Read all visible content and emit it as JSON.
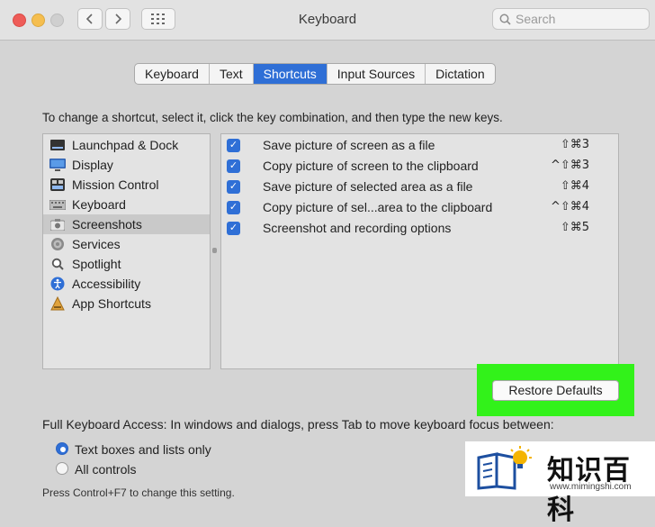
{
  "window": {
    "title": "Keyboard"
  },
  "search": {
    "placeholder": "Search"
  },
  "tabs": [
    {
      "label": "Keyboard",
      "active": false
    },
    {
      "label": "Text",
      "active": false
    },
    {
      "label": "Shortcuts",
      "active": true
    },
    {
      "label": "Input Sources",
      "active": false
    },
    {
      "label": "Dictation",
      "active": false
    }
  ],
  "intro_text": "To change a shortcut, select it, click the key combination, and then type the new keys.",
  "categories": [
    {
      "label": "Launchpad & Dock",
      "icon": "launchpad-icon",
      "selected": false
    },
    {
      "label": "Display",
      "icon": "display-icon",
      "selected": false
    },
    {
      "label": "Mission Control",
      "icon": "mission-control-icon",
      "selected": false
    },
    {
      "label": "Keyboard",
      "icon": "keyboard-icon",
      "selected": false
    },
    {
      "label": "Screenshots",
      "icon": "screenshot-icon",
      "selected": true
    },
    {
      "label": "Services",
      "icon": "gear-icon",
      "selected": false
    },
    {
      "label": "Spotlight",
      "icon": "spotlight-icon",
      "selected": false
    },
    {
      "label": "Accessibility",
      "icon": "accessibility-icon",
      "selected": false
    },
    {
      "label": "App Shortcuts",
      "icon": "app-shortcuts-icon",
      "selected": false
    }
  ],
  "shortcuts": [
    {
      "label": "Save picture of screen as a file",
      "keys": "⇧⌘3",
      "checked": true
    },
    {
      "label": "Copy picture of screen to the clipboard",
      "keys": "^⇧⌘3",
      "checked": true
    },
    {
      "label": "Save picture of selected area as a file",
      "keys": "⇧⌘4",
      "checked": true
    },
    {
      "label": "Copy picture of sel...area to the clipboard",
      "keys": "^⇧⌘4",
      "checked": true
    },
    {
      "label": "Screenshot and recording options",
      "keys": "⇧⌘5",
      "checked": true
    }
  ],
  "restore_label": "Restore Defaults",
  "full_keyboard_access": {
    "text": "Full Keyboard Access: In windows and dialogs, press Tab to move keyboard focus between:",
    "options": [
      {
        "label": "Text boxes and lists only",
        "selected": true
      },
      {
        "label": "All controls",
        "selected": false
      }
    ],
    "note": "Press Control+F7 to change this setting."
  },
  "watermark": {
    "text": "知识百科",
    "url": "www.mimingshi.com"
  },
  "colors": {
    "accent": "#2f6fd6",
    "highlight": "#32f21a"
  }
}
